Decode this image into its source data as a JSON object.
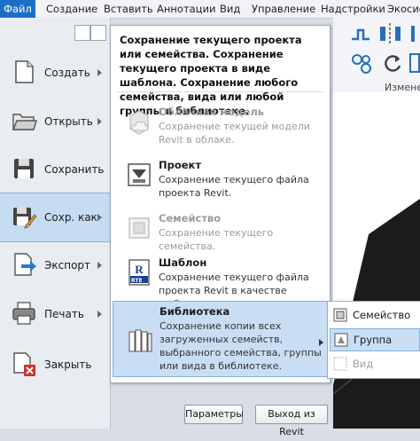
{
  "menubar": {
    "file": "Файл",
    "items": [
      "Создание",
      "Вставить",
      "Аннотации",
      "Вид",
      "Управление",
      "Надстройки",
      "Экосис"
    ]
  },
  "ribbon": {
    "panel_label": "Измене"
  },
  "app_menu": {
    "commands": [
      {
        "label": "Создать",
        "icon": "new-file-icon"
      },
      {
        "label": "Открыть",
        "icon": "open-folder-icon"
      },
      {
        "label": "Сохранить",
        "icon": "save-disk-icon"
      },
      {
        "label": "Сохр. как",
        "icon": "save-as-icon"
      },
      {
        "label": "Экспорт",
        "icon": "export-icon"
      },
      {
        "label": "Печать",
        "icon": "printer-icon"
      },
      {
        "label": "Закрыть",
        "icon": "close-document-icon"
      }
    ]
  },
  "submenu": {
    "header": "Сохранение текущего проекта или семейства. Сохранение текущего проекта в виде шаблона. Сохранение любого семейства, вида или любой группы в библиотеке.",
    "items": [
      {
        "title": "Облачная модель",
        "desc": "Сохранение текущей модели Revit в облаке."
      },
      {
        "title": "Проект",
        "desc": "Сохранение текущего файла проекта Revit."
      },
      {
        "title": "Семейство",
        "desc": "Сохранение текущего семейства."
      },
      {
        "title": "Шаблон",
        "desc": "Сохранение текущего файла проекта Revit в качестве шаблона."
      },
      {
        "title": "Библиотека",
        "desc": "Сохранение копии всех загруженных семейств, выбранного семейства, группы или вида в библиотеке."
      }
    ],
    "template_badge": "RTE"
  },
  "buttons": {
    "options": "Параметры",
    "exit": "Выход из Revit"
  },
  "flyout": {
    "items": [
      {
        "label": "Семейство"
      },
      {
        "label": "Группа"
      },
      {
        "label": "Вид"
      }
    ]
  },
  "colors": {
    "accent": "#1b6fc4",
    "highlight": "#c9def5",
    "highlight_border": "#86aedb"
  }
}
